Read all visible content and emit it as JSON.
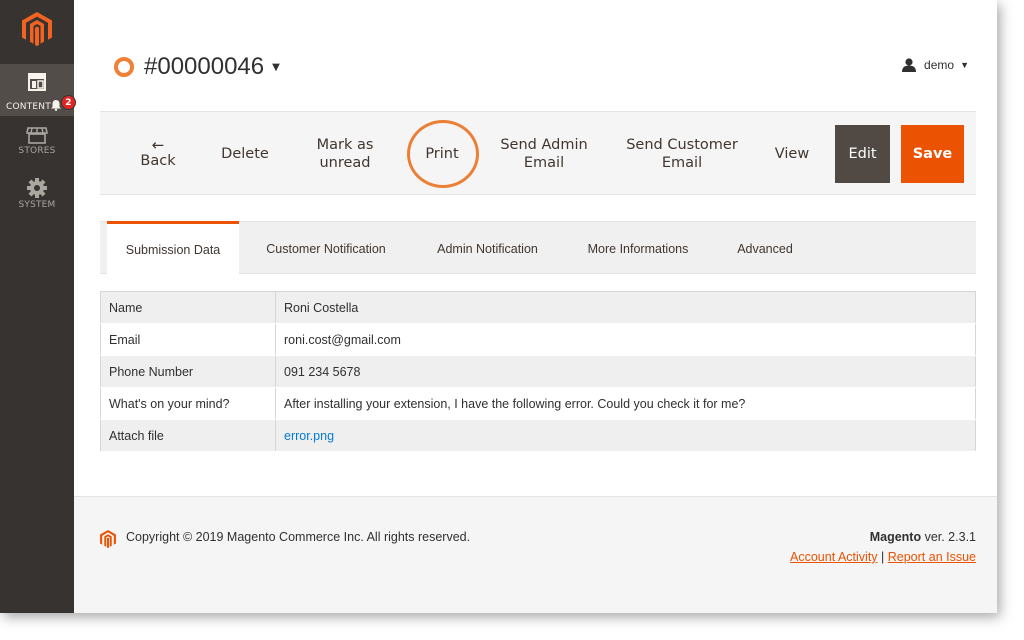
{
  "sidebar": {
    "items": [
      {
        "label": "CONTENT",
        "icon": "content-icon",
        "active": true,
        "badge": "2"
      },
      {
        "label": "STORES",
        "icon": "stores-icon"
      },
      {
        "label": "SYSTEM",
        "icon": "gear-icon"
      }
    ]
  },
  "header": {
    "title": "#00000046",
    "user": "demo"
  },
  "actions": {
    "back": "Back",
    "delete": "Delete",
    "mark_line1": "Mark as",
    "mark_line2": "unread",
    "print": "Print",
    "send_admin_line1": "Send Admin",
    "send_admin_line2": "Email",
    "send_customer_line1": "Send Customer",
    "send_customer_line2": "Email",
    "view": "View",
    "edit": "Edit",
    "save": "Save"
  },
  "tabs": [
    {
      "label": "Submission Data",
      "active": true
    },
    {
      "label": "Customer Notification"
    },
    {
      "label": "Admin Notification"
    },
    {
      "label": "More Informations"
    },
    {
      "label": "Advanced"
    }
  ],
  "submission": {
    "rows": [
      {
        "key": "Name",
        "value": "Roni Costella"
      },
      {
        "key": "Email",
        "value": "roni.cost@gmail.com"
      },
      {
        "key": "Phone Number",
        "value": "091 234 5678"
      },
      {
        "key": "What's on your mind?",
        "value": "After installing your extension, I have the following error. Could you check it for me?"
      },
      {
        "key": "Attach file",
        "value": "error.png"
      }
    ]
  },
  "footer": {
    "copyright": "Copyright © 2019 Magento Commerce Inc. All rights reserved.",
    "brand": "Magento",
    "version": " ver. 2.3.1",
    "account_activity": "Account Activity",
    "separator": " | ",
    "report_issue": "Report an Issue"
  },
  "colors": {
    "accent": "#eb5202",
    "sidebar_bg": "#373330",
    "edit_bg": "#514943",
    "link": "#007bdb"
  }
}
